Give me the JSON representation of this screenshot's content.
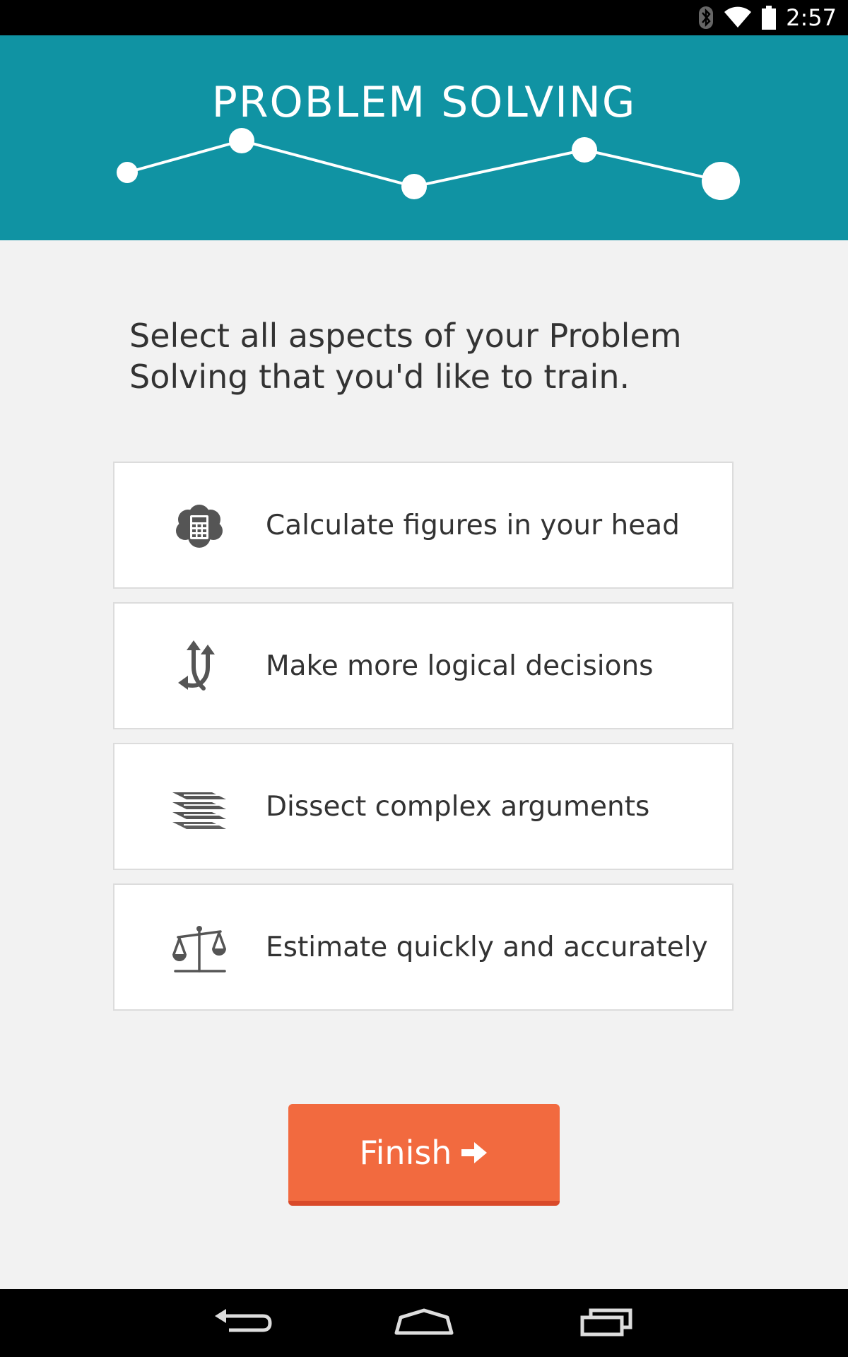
{
  "status_bar": {
    "time": "2:57",
    "icons": [
      "bluetooth-icon",
      "wifi-icon",
      "battery-icon"
    ]
  },
  "header": {
    "title": "PROBLEM SOLVING",
    "progress": {
      "steps_total": 5,
      "current_step": 5
    }
  },
  "prompt": {
    "line1": "Select all aspects of your Problem",
    "line2": "Solving that you'd like to train."
  },
  "options": [
    {
      "label": "Calculate figures in your head",
      "icon": "calculator-cloud-icon"
    },
    {
      "label": "Make more logical decisions",
      "icon": "split-arrows-icon"
    },
    {
      "label": "Dissect complex arguments",
      "icon": "layers-icon"
    },
    {
      "label": "Estimate quickly and accurately",
      "icon": "scales-icon"
    }
  ],
  "finish_button": {
    "label": "Finish",
    "icon": "arrow-right-icon"
  },
  "nav_bar": {
    "buttons": [
      "back-icon",
      "home-icon",
      "recents-icon"
    ]
  },
  "colors": {
    "header": "#1093a3",
    "background": "#f2f2f2",
    "finish": "#f26a3f",
    "text": "#333333"
  }
}
